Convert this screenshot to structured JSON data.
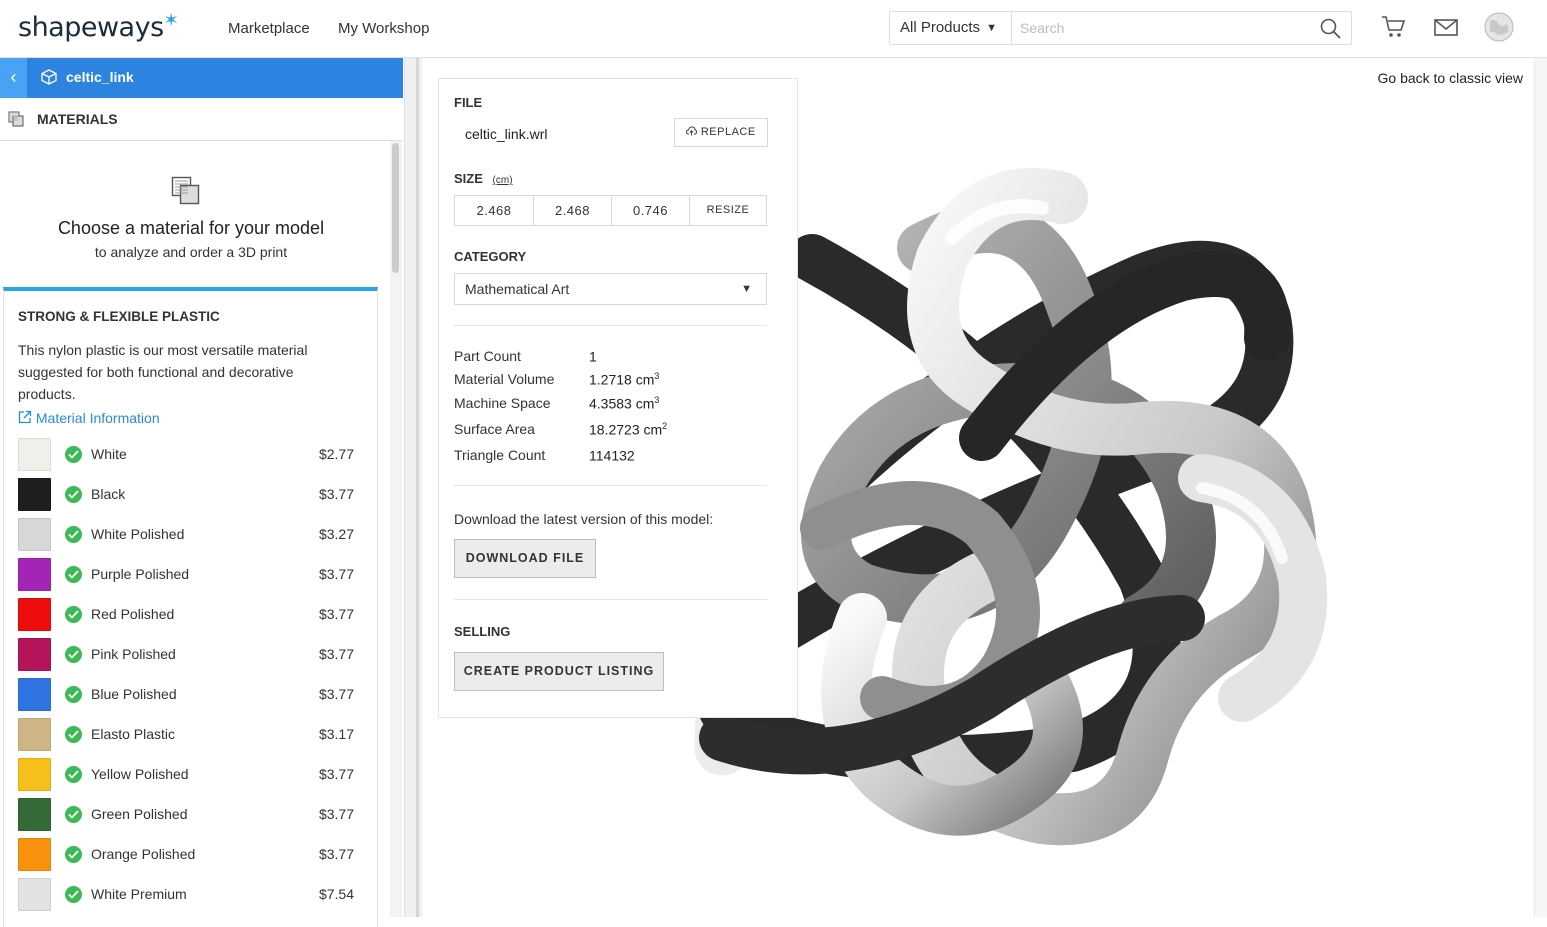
{
  "header": {
    "logo": "shapeways",
    "logo_star": "✶",
    "nav": [
      "Marketplace",
      "My Workshop"
    ],
    "search": {
      "category": "All Products",
      "placeholder": "Search"
    }
  },
  "sidebar": {
    "model_name": "celtic_link",
    "section_label": "MATERIALS",
    "choose_title": "Choose a material for your model",
    "choose_subtitle": "to analyze and order a 3D print",
    "material_group": {
      "title": "STRONG & FLEXIBLE PLASTIC",
      "description": "This nylon plastic is our most versatile material suggested for both functional and decorative products.",
      "info_link": "Material Information",
      "items": [
        {
          "name": "White",
          "price": "$2.77",
          "color": "#f1efea"
        },
        {
          "name": "Black",
          "price": "$3.77",
          "color": "#1e1e1e"
        },
        {
          "name": "White Polished",
          "price": "$3.27",
          "color": "#d7d7d7"
        },
        {
          "name": "Purple Polished",
          "price": "$3.77",
          "color": "#a424b8"
        },
        {
          "name": "Red Polished",
          "price": "$3.77",
          "color": "#ee0c0c"
        },
        {
          "name": "Pink Polished",
          "price": "$3.77",
          "color": "#b4155a"
        },
        {
          "name": "Blue Polished",
          "price": "$3.77",
          "color": "#2f74e0"
        },
        {
          "name": "Elasto Plastic",
          "price": "$3.17",
          "color": "#cdb585"
        },
        {
          "name": "Yellow Polished",
          "price": "$3.77",
          "color": "#f7bf1c"
        },
        {
          "name": "Green Polished",
          "price": "$3.77",
          "color": "#346a38"
        },
        {
          "name": "Orange Polished",
          "price": "$3.77",
          "color": "#f8920c"
        },
        {
          "name": "White Premium",
          "price": "$7.54",
          "color": "#e2e2e2"
        }
      ]
    }
  },
  "viewer": {
    "classic_link": "Go back to classic view"
  },
  "props": {
    "file_label": "FILE",
    "file_name": "celtic_link.wrl",
    "replace_label": "REPLACE",
    "size_label": "SIZE",
    "size_unit": "(cm)",
    "size_values": [
      "2.468",
      "2.468",
      "0.746"
    ],
    "resize_label": "RESIZE",
    "category_label": "CATEGORY",
    "category_value": "Mathematical Art",
    "stats": [
      {
        "label": "Part Count",
        "value": "1",
        "sup": ""
      },
      {
        "label": "Material Volume",
        "value": "1.2718 cm",
        "sup": "3"
      },
      {
        "label": "Machine Space",
        "value": "4.3583 cm",
        "sup": "3"
      },
      {
        "label": "Surface Area",
        "value": "18.2723 cm",
        "sup": "2"
      },
      {
        "label": "Triangle Count",
        "value": "114132",
        "sup": ""
      }
    ],
    "download_text": "Download the latest version of this model:",
    "download_button": "DOWNLOAD FILE",
    "selling_label": "SELLING",
    "listing_button": "CREATE PRODUCT LISTING"
  }
}
